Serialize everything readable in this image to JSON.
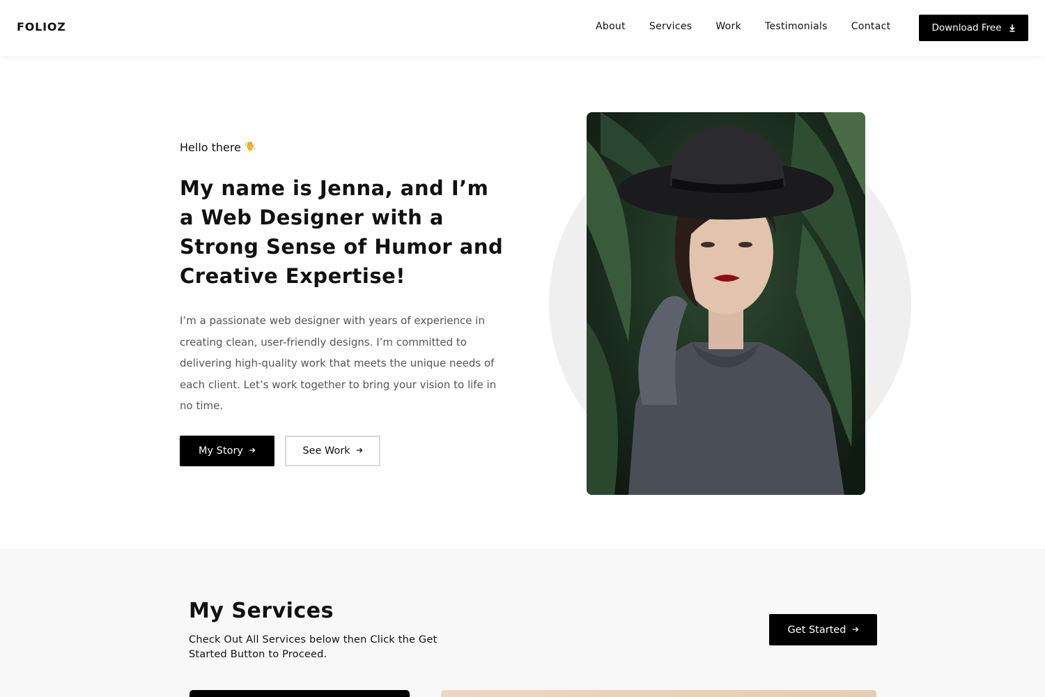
{
  "brand": {
    "logo_text": "FOLIOZ"
  },
  "nav": {
    "links": [
      {
        "label": "About"
      },
      {
        "label": "Services"
      },
      {
        "label": "Work"
      },
      {
        "label": "Testimonials"
      },
      {
        "label": "Contact"
      }
    ],
    "download_label": "Download Free",
    "download_icon": "download-icon"
  },
  "hero": {
    "greeting": "Hello there",
    "greeting_icon": "waving-hand-icon",
    "headline": "My name is Jenna, and I’m a Web Designer with a Strong Sense of Humor and Creative Expertise!",
    "intro": "I’m a passionate web designer with years of experience in creating clean, user-friendly designs. I’m committed to delivering high-quality work that meets the unique needs of each client. Let’s work together to bring your vision to life in no time.",
    "primary_button": "My Story",
    "secondary_button": "See Work",
    "button_icon": "arrow-right-icon",
    "portrait_alt": "portrait-photo"
  },
  "services": {
    "title": "My Services",
    "subtitle": "Check Out All Services below then Click the Get Started Button to Proceed.",
    "cta_label": "Get Started"
  },
  "colors": {
    "primary": "#000000",
    "text": "#111111",
    "muted_text": "#555555",
    "hero_circle": "#efefef",
    "services_bg": "#f8f8f8"
  }
}
